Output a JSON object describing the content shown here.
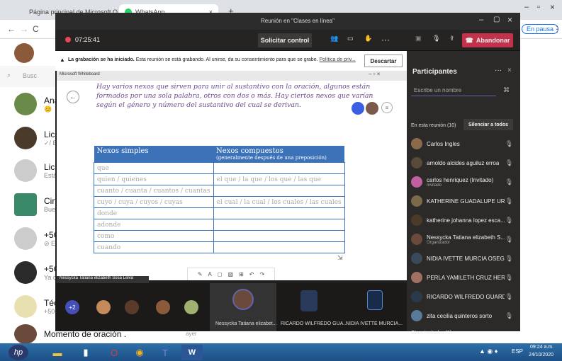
{
  "browser": {
    "tab1": "Página principal de Microsoft O",
    "tab2": "WhatsApp",
    "tab_close": "×",
    "new_tab": "+",
    "win_min": "–",
    "win_max": "▫",
    "win_close": "×",
    "pause_badge": "En pausa",
    "menu_dots": "⋮"
  },
  "whatsapp": {
    "search_placeholder": "Busc",
    "chats": [
      {
        "name": "Ana",
        "sub": "😊"
      },
      {
        "name": "Lic",
        "sub": "✓/ E"
      },
      {
        "name": "Lic",
        "sub": "Está"
      },
      {
        "name": "Cin",
        "sub": "Buer"
      },
      {
        "name": "+5C",
        "sub": "⊘ E"
      },
      {
        "name": "+5C",
        "sub": "Ya q"
      },
      {
        "name": "Téc",
        "sub": "+50"
      }
    ],
    "last_chat": {
      "name": "Momento de oración .",
      "time": "ayer"
    }
  },
  "teams": {
    "window_title": "Reunión en \"Clases en línea\"",
    "timer": "07:25:41",
    "request_control": "Solicitar control",
    "leave": "Abandonar",
    "recording_notice_bold": "La grabación se ha iniciado.",
    "recording_notice": "Esta reunión se está grabando. Al unirse, da su consentimiento para que se grabe.",
    "privacy_link": "Política de priv...",
    "dismiss": "Descartar",
    "share": {
      "app_title": "Microsoft Whiteboard",
      "text": "Hay varios nexos que sirven para unir al sustantivo con la oración, algunos están formados por una sola palabra, otros con dos o más. Hay ciertos nexos que varían según el género y número del sustantivo del cual se derivan.",
      "table": {
        "col1_header": "Nexos simples",
        "col2_header": "Nexos compuestos",
        "col2_sub": "(generalmente después de una preposición)",
        "rows": [
          [
            "que",
            ""
          ],
          [
            "quien / quienes",
            "el que / la que / los que / las que"
          ],
          [
            "cuanto / cuanta / cuantos / cuantas",
            ""
          ],
          [
            "cuyo / cuya / cuyos / cuyas",
            "el cual / la cual / los cuales / las cuales"
          ],
          [
            "donde",
            ""
          ],
          [
            "adonde",
            ""
          ],
          [
            "como",
            ""
          ],
          [
            "cuando",
            ""
          ]
        ]
      },
      "presenter_label": "Nessycka Tatiana elizabeth Sosa Leiva"
    },
    "participants": {
      "title": "Participantes",
      "search_placeholder": "Escribe un nombre",
      "in_meeting": "En esta reunión (10)",
      "mute_all": "Silenciar a todos",
      "list": [
        {
          "name": "Carlos Ingles",
          "role": ""
        },
        {
          "name": "arnoldo alcides aguiluz erroa",
          "role": ""
        },
        {
          "name": "carlos henriquez (Invitado)",
          "role": "Invitado"
        },
        {
          "name": "KATHERINE GUADALUPE UR...",
          "role": ""
        },
        {
          "name": "katherine johanna lopez esca...",
          "role": ""
        },
        {
          "name": "Nessycka Tatiana elizabeth S...",
          "role": "Organizador"
        },
        {
          "name": "NIDIA IVETTE MURCIA OSEG...",
          "role": ""
        },
        {
          "name": "PERLA YAMILETH CRUZ HERN...",
          "role": ""
        },
        {
          "name": "RICARDO WILFREDO GUARD...",
          "role": ""
        },
        {
          "name": "zita cecilia quinteros sorto",
          "role": ""
        }
      ],
      "others": "Otros invitados (1)"
    },
    "stage": {
      "more_count": "+2",
      "names": [
        "Nessycka Tatiana elizabet...",
        "RICARDO WILFREDO GUA...",
        "NIDIA IVETTE MURCIA..."
      ]
    }
  },
  "taskbar": {
    "lang": "ESP",
    "time": "09:24 a.m.",
    "date": "24/10/2020"
  },
  "colors": {
    "teams_dark": "#201f1f",
    "leave_red": "#c4314b",
    "table_blue": "#3c73b8",
    "whiteboard_purple": "#6c4b8f"
  }
}
